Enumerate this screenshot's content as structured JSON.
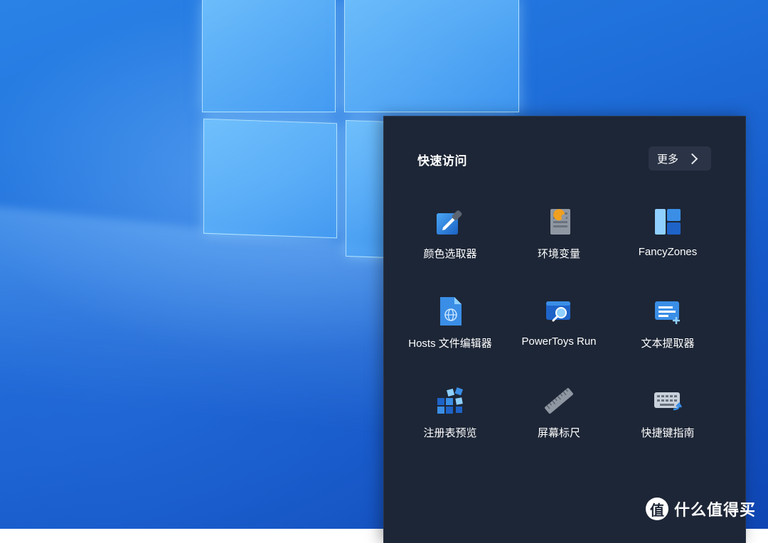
{
  "flyout": {
    "title": "快速访问",
    "more_label": "更多",
    "tools": [
      {
        "label": "颜色选取器",
        "icon": "color-picker-icon"
      },
      {
        "label": "环境变量",
        "icon": "environment-variables-icon"
      },
      {
        "label": "FancyZones",
        "icon": "fancyzones-icon"
      },
      {
        "label": "Hosts 文件编辑器",
        "icon": "hosts-file-editor-icon"
      },
      {
        "label": "PowerToys Run",
        "icon": "powertoys-run-icon"
      },
      {
        "label": "文本提取器",
        "icon": "text-extractor-icon"
      },
      {
        "label": "注册表预览",
        "icon": "registry-preview-icon"
      },
      {
        "label": "屏幕标尺",
        "icon": "screen-ruler-icon"
      },
      {
        "label": "快捷键指南",
        "icon": "shortcut-guide-icon"
      }
    ]
  },
  "watermark": {
    "badge": "值",
    "text": "什么值得买"
  },
  "colors": {
    "flyout_bg": "#1d2636",
    "button_bg": "#2b3446",
    "accent_blue": "#3a8ee6"
  }
}
